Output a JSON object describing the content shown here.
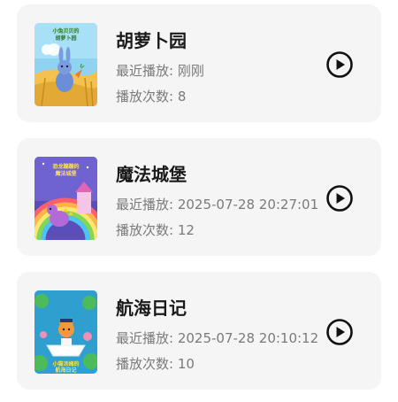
{
  "labels": {
    "last_played_prefix": "最近播放: ",
    "play_count_prefix": "播放次数: "
  },
  "stories": [
    {
      "title": "胡萝卜园",
      "last_played": "刚刚",
      "play_count": "8",
      "cover_text": "小兔贝贝的胡萝卜园",
      "cover_palette": "wheat-field-blue-sky"
    },
    {
      "title": "魔法城堡",
      "last_played": "2025-07-28 20:27:01",
      "play_count": "12",
      "cover_text": "恐龙蹦蹦的魔法城堡",
      "cover_palette": "rainbow-castle-purple-night"
    },
    {
      "title": "航海日记",
      "last_played": "2025-07-28 20:10:12",
      "play_count": "10",
      "cover_text": "小猫汤姆的航海日记",
      "cover_palette": "lily-pond-blue-teal"
    }
  ],
  "colors": {
    "card_background": "#f5f5f5",
    "title_text": "#1a1a1a",
    "meta_text": "#7a7a7a",
    "play_icon": "#111111"
  }
}
